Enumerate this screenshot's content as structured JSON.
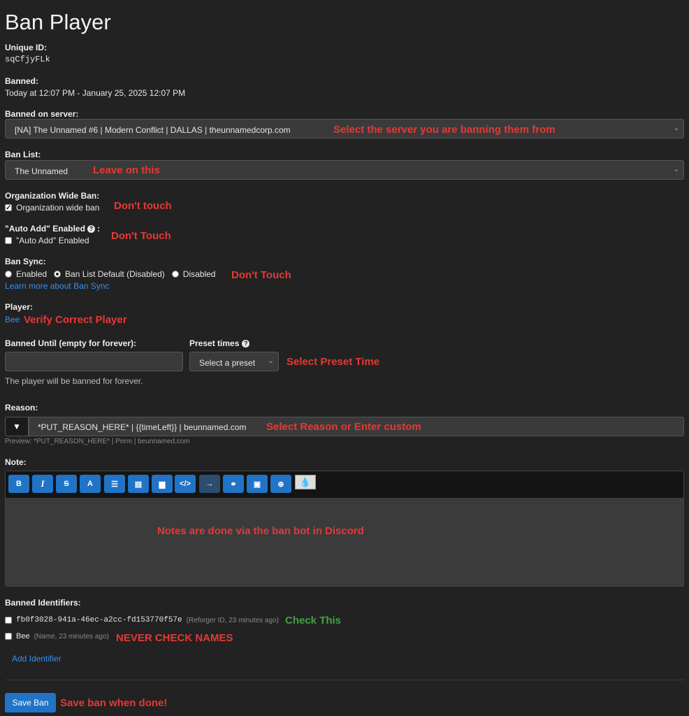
{
  "page": {
    "title": "Ban Player"
  },
  "unique_id": {
    "label": "Unique ID:",
    "value": "sqCfjyFLk"
  },
  "banned": {
    "label": "Banned:",
    "value": "Today at 12:07 PM - January 25, 2025 12:07 PM"
  },
  "server": {
    "label": "Banned on server:",
    "selected": "[NA] The Unnamed #6 | Modern Conflict | DALLAS | theunnamedcorp.com",
    "annotation": "Select the server you are banning them from"
  },
  "ban_list": {
    "label": "Ban List:",
    "selected": "The Unnamed",
    "annotation": "Leave on this"
  },
  "org_ban": {
    "label": "Organization Wide Ban:",
    "checkbox_label": "Organization wide ban",
    "checked": true,
    "annotation": "Don't touch"
  },
  "auto_add": {
    "label": "\"Auto Add\" Enabled",
    "label_suffix": ":",
    "checkbox_label": "\"Auto Add\" Enabled",
    "checked": false,
    "annotation": "Don't Touch"
  },
  "ban_sync": {
    "label": "Ban Sync:",
    "options": [
      "Enabled",
      "Ban List Default (Disabled)",
      "Disabled"
    ],
    "selected_index": 1,
    "learn_more": "Learn more about Ban Sync",
    "annotation": "Don't Touch"
  },
  "player": {
    "label": "Player:",
    "name": "Bee",
    "annotation": "Verify Correct Player"
  },
  "banned_until": {
    "label": "Banned Until (empty for forever):",
    "value": "",
    "help": "The player will be banned for forever."
  },
  "preset": {
    "label": "Preset times",
    "selected": "Select a preset",
    "annotation": "Select Preset Time"
  },
  "reason": {
    "label": "Reason:",
    "value": "*PUT_REASON_HERE* | {{timeLeft}} | beunnamed.com",
    "preview": "Preview: *PUT_REASON_HERE* | Perm | beunnamed.com",
    "annotation": "Select Reason or Enter custom"
  },
  "note": {
    "label": "Note:",
    "toolbar": [
      {
        "name": "bold-button",
        "glyph": "B"
      },
      {
        "name": "italic-button",
        "glyph": "I"
      },
      {
        "name": "strikethrough-button",
        "glyph": "S"
      },
      {
        "name": "text-color-button",
        "glyph": "A"
      },
      {
        "name": "list-button",
        "glyph": "☰"
      },
      {
        "name": "numbered-list-button",
        "glyph": "▤"
      },
      {
        "name": "quote-button",
        "glyph": "▆"
      },
      {
        "name": "code-button",
        "glyph": "</>"
      },
      {
        "name": "indent-button",
        "glyph": "→"
      },
      {
        "name": "link-button",
        "glyph": "⚭"
      },
      {
        "name": "image-button",
        "glyph": "▣"
      },
      {
        "name": "embed-button",
        "glyph": "⊕"
      }
    ],
    "annotation": "Notes are done via the ban bot in Discord"
  },
  "identifiers": {
    "label": "Banned Identifiers:",
    "items": [
      {
        "value": "fb0f3028-941a-46ec-a2cc-fd153770f57e",
        "meta": "(Reforger ID, 23 minutes ago)",
        "annotation": "Check This",
        "annotation_color": "#43a047"
      },
      {
        "value": "Bee",
        "meta": "(Name, 23 minutes ago)",
        "annotation": "NEVER CHECK NAMES",
        "annotation_color": "#e53935"
      }
    ],
    "add_link": "Add Identifier"
  },
  "save": {
    "label": "Save Ban",
    "annotation": "Save ban when done!"
  }
}
